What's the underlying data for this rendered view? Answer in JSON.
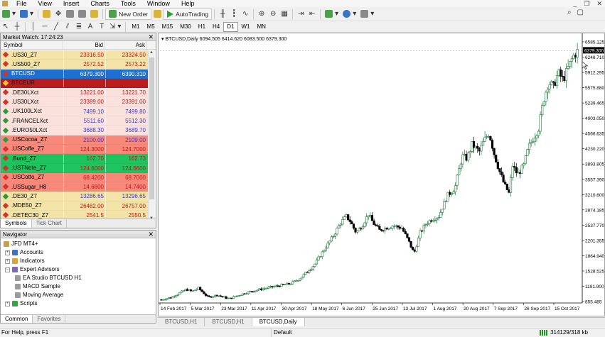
{
  "menu": [
    "File",
    "View",
    "Insert",
    "Charts",
    "Tools",
    "Window",
    "Help"
  ],
  "toolbar": {
    "new_order": "New Order",
    "autotrading": "AutoTrading",
    "timeframes": [
      "M1",
      "M5",
      "M15",
      "M30",
      "H1",
      "H4",
      "D1",
      "W1",
      "MN"
    ],
    "active_timeframe": "D1"
  },
  "market_watch": {
    "title": "Market Watch: 17:24:23",
    "col_symbol": "Symbol",
    "col_bid": "Bid",
    "col_ask": "Ask",
    "rows": [
      {
        "symbol": ".US30_Z7",
        "bid": "23316.50",
        "ask": "23324.50",
        "bg": "#f3e3a6",
        "fg": "#c01818",
        "icon": "#d0342c"
      },
      {
        "symbol": ".US500_Z7",
        "bid": "2572.52",
        "ask": "2573.22",
        "bg": "#f3e3a6",
        "fg": "#c01818",
        "icon": "#d0342c"
      },
      {
        "symbol": "BTCUSD",
        "bid": "6379.300",
        "ask": "6390.310",
        "bg": "#1f6fd1",
        "fg": "#ffffff",
        "icon": "#d0342c",
        "symfg": "#ffffff"
      },
      {
        "symbol": "BTCEUR",
        "bid": "",
        "ask": "",
        "bg": "#b81c1c",
        "fg": "#ffffff",
        "icon": "#e8c23a",
        "symfg": "#1a1a1a"
      },
      {
        "symbol": ".DE30LXct",
        "bid": "13221.00",
        "ask": "13221.70",
        "bg": "#fbe1dc",
        "fg": "#c01818",
        "icon": "#d0342c"
      },
      {
        "symbol": ".US30LXct",
        "bid": "23389.00",
        "ask": "23391.00",
        "bg": "#fbe1dc",
        "fg": "#c01818",
        "icon": "#d0342c"
      },
      {
        "symbol": ".UK100LXct",
        "bid": "7499.10",
        "ask": "7499.80",
        "bg": "#fbe1dc",
        "fg": "#3a3ad0",
        "icon": "#2e9a3e"
      },
      {
        "symbol": ".FRANCELXct",
        "bid": "5511.60",
        "ask": "5512.30",
        "bg": "#fbe1dc",
        "fg": "#3a3ad0",
        "icon": "#2e9a3e"
      },
      {
        "symbol": ".EURO50LXct",
        "bid": "3688.30",
        "ask": "3689.70",
        "bg": "#fbe1dc",
        "fg": "#3a3ad0",
        "icon": "#2e9a3e"
      },
      {
        "symbol": ".USCocoa_Z7",
        "bid": "2100.00",
        "ask": "2109.00",
        "bg": "#f7887a",
        "fg": "#3a3ad0",
        "icon": "#2e9a3e"
      },
      {
        "symbol": ".USCoffe_Z7",
        "bid": "124.3000",
        "ask": "124.7000",
        "bg": "#f7887a",
        "fg": "#c01818",
        "icon": "#d0342c"
      },
      {
        "symbol": ".Bund_Z7",
        "bid": "162.70",
        "ask": "162.73",
        "bg": "#1ec45e",
        "fg": "#c01818",
        "icon": "#d0342c"
      },
      {
        "symbol": ".USTNote_Z7",
        "bid": "124.6000",
        "ask": "124.6600",
        "bg": "#1ec45e",
        "fg": "#c01818",
        "icon": "#d0342c"
      },
      {
        "symbol": ".USCotto_Z7",
        "bid": "68.4200",
        "ask": "68.7000",
        "bg": "#f7887a",
        "fg": "#c01818",
        "icon": "#d0342c"
      },
      {
        "symbol": ".USSugar_H8",
        "bid": "14.6800",
        "ask": "14.7400",
        "bg": "#f7887a",
        "fg": "#c01818",
        "icon": "#d0342c"
      },
      {
        "symbol": ".DE30_Z7",
        "bid": "13286.65",
        "ask": "13296.65",
        "bg": "#f3e3a6",
        "fg": "#3a3ad0",
        "icon": "#2e9a3e"
      },
      {
        "symbol": ".MDE50_Z7",
        "bid": "26482.00",
        "ask": "26757.00",
        "bg": "#f3e3a6",
        "fg": "#c01818",
        "icon": "#d0342c"
      },
      {
        "symbol": ".DETEC30_Z7",
        "bid": "2541.5",
        "ask": "2550.5",
        "bg": "#f3e3a6",
        "fg": "#c01818",
        "icon": "#d0342c"
      }
    ],
    "tabs": [
      "Symbols",
      "Tick Chart"
    ]
  },
  "navigator": {
    "title": "Navigator",
    "root": "JFD MT4+",
    "items": [
      {
        "label": "Accounts",
        "level": 1,
        "exp": "+",
        "icon": "#3b74c4",
        "name": "accounts"
      },
      {
        "label": "Indicators",
        "level": 1,
        "exp": "+",
        "icon": "#d9a43a",
        "name": "indicators"
      },
      {
        "label": "Expert Advisors",
        "level": 1,
        "exp": "−",
        "icon": "#7a6bb5",
        "name": "expert-advisors"
      },
      {
        "label": "EA Studio BTCUSD H1",
        "level": 2,
        "exp": "",
        "icon": "#9b9b9b",
        "name": "ea-studio"
      },
      {
        "label": "MACD Sample",
        "level": 2,
        "exp": "",
        "icon": "#9b9b9b",
        "name": "macd-sample"
      },
      {
        "label": "Moving Average",
        "level": 2,
        "exp": "",
        "icon": "#9b9b9b",
        "name": "moving-average"
      },
      {
        "label": "Scripts",
        "level": 1,
        "exp": "+",
        "icon": "#3ba14a",
        "name": "scripts"
      }
    ],
    "tabs": [
      "Common",
      "Favorites"
    ]
  },
  "chart": {
    "header": "BTCUSD,Daily  6094.505 6414.620 6083.500 6379.300",
    "current_price": "6379.300",
    "tabs": [
      "BTCUSD,H1",
      "BTCUSD,H1",
      "BTCUSD,Daily"
    ],
    "active_tab": 2
  },
  "chart_data": {
    "type": "candlestick",
    "symbol": "BTCUSD",
    "timeframe": "Daily",
    "ylim": [
      930,
      6630
    ],
    "y_ticks": [
      "6585.125",
      "6248.710",
      "5912.295",
      "5575.880",
      "5239.465",
      "4903.050",
      "4566.635",
      "4230.220",
      "3893.805",
      "3557.390",
      "3210.600",
      "2874.185",
      "2537.770",
      "2201.355",
      "1864.940",
      "1528.525",
      "1191.900",
      "855.485"
    ],
    "x_ticks": [
      "14 Feb 2017",
      "5 Mar 2017",
      "23 Mar 2017",
      "11 Apr 2017",
      "30 Apr 2017",
      "18 May 2017",
      "6 Jun 2017",
      "25 Jun 2017",
      "13 Jul 2017",
      "1 Aug 2017",
      "20 Aug 2017",
      "7 Sep 2017",
      "26 Sep 2017",
      "15 Oct 2017"
    ],
    "close_path": [
      [
        0,
        1000
      ],
      [
        8,
        1050
      ],
      [
        15,
        1150
      ],
      [
        20,
        1220
      ],
      [
        25,
        1180
      ],
      [
        30,
        1250
      ],
      [
        38,
        1050
      ],
      [
        45,
        1100
      ],
      [
        55,
        1020
      ],
      [
        62,
        1090
      ],
      [
        70,
        1160
      ],
      [
        78,
        1210
      ],
      [
        85,
        1250
      ],
      [
        95,
        1300
      ],
      [
        105,
        1350
      ],
      [
        112,
        1450
      ],
      [
        118,
        1600
      ],
      [
        124,
        1750
      ],
      [
        130,
        2000
      ],
      [
        135,
        2200
      ],
      [
        140,
        2400
      ],
      [
        145,
        2650
      ],
      [
        150,
        2800
      ],
      [
        153,
        2700
      ],
      [
        158,
        2450
      ],
      [
        163,
        2600
      ],
      [
        168,
        2850
      ],
      [
        172,
        2650
      ],
      [
        177,
        2500
      ],
      [
        182,
        2550
      ],
      [
        188,
        2600
      ],
      [
        195,
        2550
      ],
      [
        200,
        2300
      ],
      [
        205,
        2000
      ],
      [
        210,
        2450
      ],
      [
        215,
        2650
      ],
      [
        220,
        2750
      ],
      [
        225,
        2800
      ],
      [
        232,
        3250
      ],
      [
        238,
        3400
      ],
      [
        244,
        4100
      ],
      [
        248,
        4050
      ],
      [
        252,
        4350
      ],
      [
        258,
        4200
      ],
      [
        262,
        4450
      ],
      [
        266,
        4600
      ],
      [
        270,
        4150
      ],
      [
        274,
        3800
      ],
      [
        278,
        3500
      ],
      [
        282,
        3300
      ],
      [
        285,
        3900
      ],
      [
        289,
        3700
      ],
      [
        294,
        3900
      ],
      [
        298,
        4300
      ],
      [
        302,
        4500
      ],
      [
        306,
        4700
      ],
      [
        310,
        5300
      ],
      [
        314,
        5700
      ],
      [
        318,
        5600
      ],
      [
        322,
        5900
      ],
      [
        326,
        5750
      ],
      [
        330,
        6000
      ],
      [
        334,
        6250
      ],
      [
        338,
        6379
      ]
    ],
    "last_price": 6379.3
  }
}
